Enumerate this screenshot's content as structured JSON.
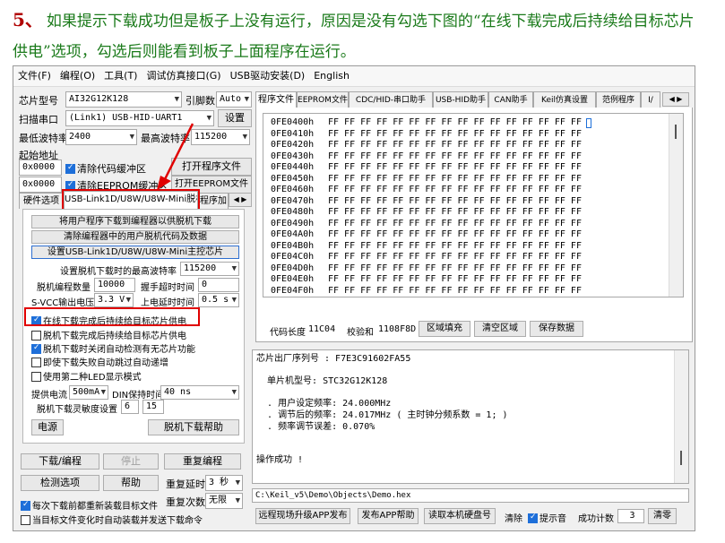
{
  "caption": {
    "number": "5、",
    "line1": "如果提示下载成功但是板子上没有运行，原因是没有勾选下图的“在线下载完成后持续给目标芯片",
    "line2": "供电”选项，勾选后则能看到板子上面程序在运行。"
  },
  "menu": [
    "文件(F)",
    "编程(O)",
    "工具(T)",
    "调试仿真接口(G)",
    "USB驱动安装(D)",
    "English"
  ],
  "left": {
    "chip_label": "芯片型号",
    "chip_value": "AI32G12K128",
    "pins_label": "引脚数",
    "pins_value": "Auto",
    "scan_label": "扫描串口",
    "port_value": "(Link1) USB-HID-UART1",
    "settings_btn": "设置",
    "min_baud_label": "最低波特率",
    "min_baud_value": "2400",
    "max_baud_label": "最高波特率",
    "max_baud_value": "115200",
    "start_addr_label": "起始地址",
    "addr1": "0x0000",
    "clear_code": "清除代码缓冲区",
    "open_prog": "打开程序文件",
    "addr2": "0x0000",
    "clear_eeprom": "清除EEPROM缓冲区",
    "open_eeprom": "打开EEPROM文件",
    "tabs": [
      "硬件选项",
      "USB-Link1D/U8W/U8W-Mini脱机",
      "程序加"
    ],
    "panel_btn1": "将用户程序下载到编程器以供脱机下载",
    "panel_btn2": "清除编程器中的用户脱机代码及数据",
    "panel_btn3": "设置USB-Link1D/U8W/U8W-Mini主控芯片",
    "offline_baud_label": "设置脱机下载时的最高波特率",
    "offline_baud_value": "115200",
    "prog_count_label": "脱机编程数量",
    "prog_count_value": "10000",
    "hs_timeout_label": "握手超时时间",
    "hs_timeout_value": "0",
    "svcc_label": "S-VCC输出电压",
    "svcc_value": "3.3 V",
    "poweron_delay_label": "上电延时时间",
    "poweron_delay_value": "0.5 s",
    "opt_power": "在线下载完成后持续给目标芯片供电",
    "opt_power_offline": "脱机下载完成后持续给目标芯片供电",
    "opt_auto_detect": "脱机下载时关闭自动检测有无芯片功能",
    "opt_fail_beep": "即使下载失败自动跳过自动递增",
    "opt_led": "使用第二种LED显示模式",
    "supply_label": "提供电流",
    "supply_value": "500mA",
    "din_label": "DIN保持时间",
    "din_value": "40 ns",
    "sens_label": "脱机下载灵敏度设置",
    "sens_a": "6",
    "sens_b": "15",
    "power_btn": "电源",
    "offline_help_btn": "脱机下载帮助",
    "download_btn": "下载/编程",
    "stop_btn": "停止",
    "reprogram_btn": "重复编程",
    "detect_btn": "检测选项",
    "help_btn": "帮助",
    "repeat_delay_label": "重复延时",
    "repeat_delay_value": "3 秒",
    "repeat_count_label": "重复次数",
    "repeat_count_value": "无限",
    "opt_reload": "每次下载前都重新装载目标文件",
    "opt_autosend": "当目标文件变化时自动装载并发送下载命令"
  },
  "right": {
    "tabs": [
      "程序文件",
      "EEPROM文件",
      "CDC/HID-串口助手",
      "USB-HID助手",
      "CAN助手",
      "Keil仿真设置",
      "范例程序",
      "I/"
    ],
    "hex_bytes": "FF FF FF FF FF FF FF FF FF FF FF FF FF FF FF FF",
    "hex_rows": [
      "0FE0400h",
      "0FE0410h",
      "0FE0420h",
      "0FE0430h",
      "0FE0440h",
      "0FE0450h",
      "0FE0460h",
      "0FE0470h",
      "0FE0480h",
      "0FE0490h",
      "0FE04A0h",
      "0FE04B0h",
      "0FE04C0h",
      "0FE04D0h",
      "0FE04E0h",
      "0FE04F0h"
    ],
    "code_len_label": "代码长度",
    "code_len_value": "11C04",
    "checksum_label": "校验和",
    "checksum_value": "1108F8D",
    "clear_area_btn": "区域填充",
    "clear_zone_btn": "清空区域",
    "save_btn": "保存数据",
    "log_lines": [
      "芯片出厂序列号 : F7E3C91602FA55",
      "",
      "  单片机型号: STC32G12K128",
      "",
      "  . 用户设定频率: 24.000MHz",
      "  . 调节后的频率: 24.017MHz ( 主时钟分频系数 = 1; )",
      "  . 频率调节误差: 0.070%",
      "",
      "",
      "操作成功 !"
    ],
    "path": "C:\\Keil_v5\\Demo\\Objects\\Demo.hex",
    "remote_upgrade_btn": "远程现场升级APP发布",
    "publish_help_btn": "发布APP帮助",
    "read_serial_btn": "读取本机硬盘号",
    "clear_label": "清除",
    "beep_label": "提示音",
    "success_count_label": "成功计数",
    "success_count_value": "3",
    "clear_btn": "清零"
  }
}
